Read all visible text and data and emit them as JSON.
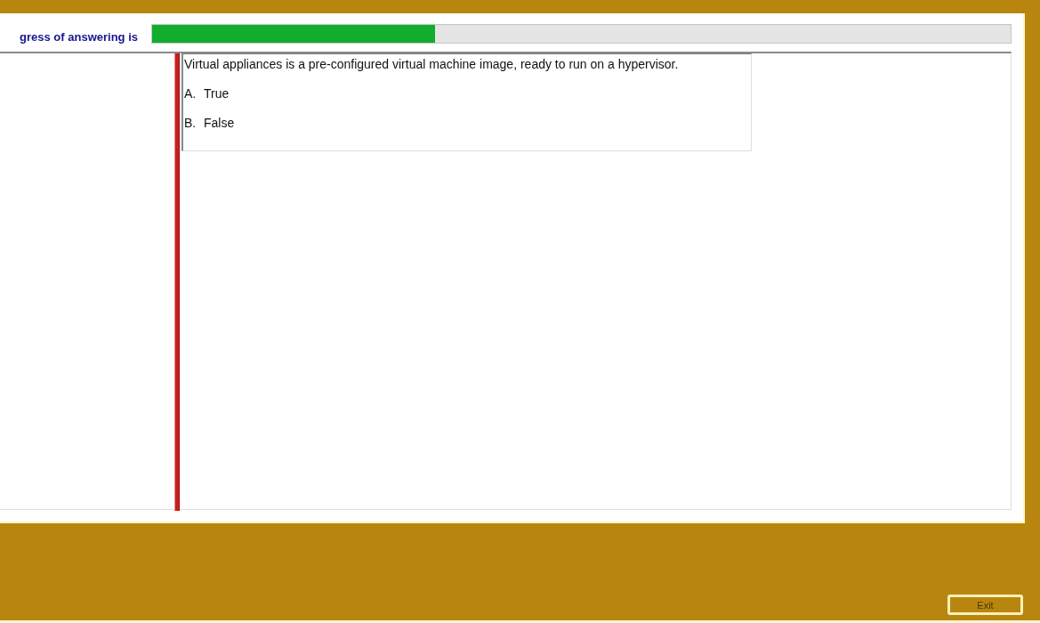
{
  "progress": {
    "label": "gress of answering is",
    "level": 0.33
  },
  "question": {
    "text": "Virtual appliances is a pre-configured virtual machine image, ready to run on a hypervisor.",
    "options": [
      {
        "letter": "A.",
        "text": "True"
      },
      {
        "letter": "B.",
        "text": "False"
      }
    ]
  },
  "buttons": [
    {
      "label": "Exit"
    }
  ]
}
